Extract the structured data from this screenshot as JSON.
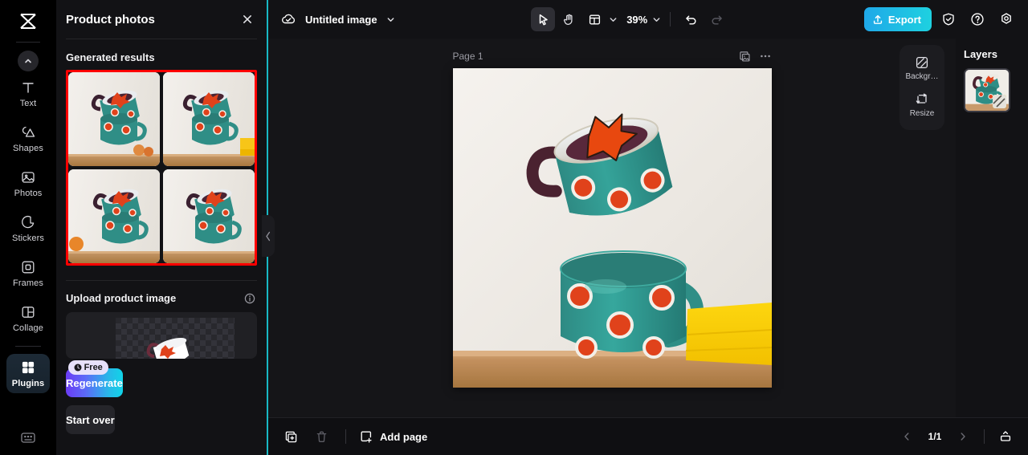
{
  "app": {
    "logo_icon": "capcut-logo",
    "background": "#0b0b0d",
    "accent_cyan": "#18b8c4",
    "annotation_color": "#ff0000"
  },
  "sidebar": {
    "collapse_icon": "chevron-up-icon",
    "items": [
      {
        "label": "Text",
        "icon": "text-icon",
        "active": false
      },
      {
        "label": "Shapes",
        "icon": "shapes-icon",
        "active": false
      },
      {
        "label": "Photos",
        "icon": "photos-icon",
        "active": false
      },
      {
        "label": "Stickers",
        "icon": "stickers-icon",
        "active": false
      },
      {
        "label": "Frames",
        "icon": "frames-icon",
        "active": false
      },
      {
        "label": "Collage",
        "icon": "collage-icon",
        "active": false
      },
      {
        "label": "Plugins",
        "icon": "plugins-icon",
        "active": true
      }
    ],
    "bottom_icon": "keyboard-icon"
  },
  "panel": {
    "title": "Product photos",
    "close_icon": "close-icon",
    "generated_section_title": "Generated results",
    "results": [
      {
        "name": "result-1",
        "alt": "Stacked teal polka dot mugs with peaches"
      },
      {
        "name": "result-2",
        "alt": "Stacked teal polka dot mugs with yellow towel"
      },
      {
        "name": "result-3",
        "alt": "Stacked teal polka dot mugs with orange"
      },
      {
        "name": "result-4",
        "alt": "Stacked teal polka dot mugs on shelf"
      }
    ],
    "upload": {
      "title": "Upload product image",
      "info_icon": "info-icon",
      "preview_name": "transparent-product-preview"
    },
    "regenerate_label": "Regenerate",
    "free_badge": {
      "label": "Free",
      "icon": "clock-icon"
    },
    "start_over_label": "Start over",
    "collapse_handle_icon": "chevron-left-icon"
  },
  "toolbar": {
    "cloud_icon": "cloud-saved-icon",
    "doc_name": "Untitled image",
    "doc_chevron_icon": "chevron-down-icon",
    "select_tool_icon": "cursor-select-icon",
    "hand_tool_icon": "hand-pan-icon",
    "layout_tool_icon": "layout-panel-icon",
    "layout_chevron_icon": "chevron-down-icon",
    "zoom_value": "39%",
    "zoom_chevron_icon": "chevron-down-icon",
    "undo_icon": "undo-icon",
    "redo_icon": "redo-icon",
    "export_label": "Export",
    "export_icon": "upload-icon",
    "shield_icon": "shield-check-icon",
    "help_icon": "help-circle-icon",
    "settings_icon": "settings-gear-icon"
  },
  "canvas": {
    "page_label": "Page 1",
    "duplicate_page_icon": "duplicate-page-icon",
    "more_icon": "more-horizontal-icon",
    "artboard_alt": "Two stacked teal polka dot mugs with maple leaf and yellow towel on wooden shelf"
  },
  "right_tools": [
    {
      "label": "Backgr…",
      "icon": "background-icon",
      "name": "background-button"
    },
    {
      "label": "Resize",
      "icon": "resize-icon",
      "name": "resize-button"
    }
  ],
  "layers": {
    "title": "Layers",
    "items": [
      {
        "name": "layer-image-1",
        "alt": "Mug product image layer",
        "badge_icon": "mask-badge-icon"
      }
    ]
  },
  "bottombar": {
    "duplicate_icon": "duplicate-icon",
    "delete_icon": "trash-icon",
    "add_page_label": "Add page",
    "add_page_icon": "add-page-icon",
    "prev_icon": "chevron-left-icon",
    "next_icon": "chevron-right-icon",
    "page_indicator": "1/1",
    "export_tray_icon": "export-tray-icon"
  }
}
